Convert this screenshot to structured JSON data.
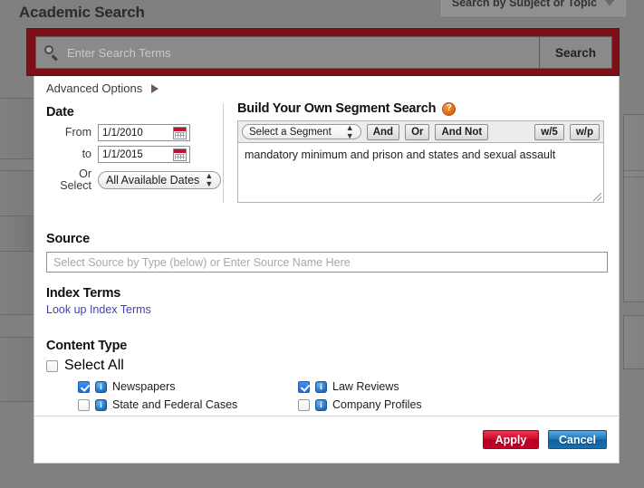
{
  "header": {
    "title": "Academic Search",
    "subject_tab_label": "Search by Subject or Topic"
  },
  "search_bar": {
    "placeholder": "Enter Search Terms",
    "value": "",
    "button_label": "Search",
    "icon": "search-icon"
  },
  "advanced_options": {
    "label": "Advanced Options",
    "caret_icon": "triangle-right-icon"
  },
  "date": {
    "title": "Date",
    "from_label": "From",
    "from_value": "1/1/2010",
    "to_label": "to",
    "to_value": "1/1/2015",
    "or_select_label": "Or Select",
    "or_select_value": "All Available Dates",
    "calendar_icon": "calendar-icon"
  },
  "segment": {
    "title": "Build Your Own Segment Search",
    "help_icon": "help-icon",
    "help_glyph": "?",
    "select_label": "Select a Segment",
    "buttons": [
      "And",
      "Or",
      "And Not",
      "w/5",
      "w/p"
    ],
    "query_text": "mandatory minimum and prison and states and sexual assault"
  },
  "source": {
    "title": "Source",
    "placeholder": "Select Source by Type (below) or Enter Source Name Here",
    "value": ""
  },
  "index_terms": {
    "title": "Index Terms",
    "link_label": "Look up Index Terms"
  },
  "content_type": {
    "title": "Content Type",
    "select_all_label": "Select All",
    "select_all_checked": false,
    "items": [
      {
        "label": "Newspapers",
        "checked": true
      },
      {
        "label": "Law Reviews",
        "checked": true
      },
      {
        "label": "State and Federal Cases",
        "checked": false
      },
      {
        "label": "Company Profiles",
        "checked": false
      }
    ]
  },
  "footer": {
    "apply_label": "Apply",
    "cancel_label": "Cancel"
  },
  "colors": {
    "band_red": "#7b1019",
    "apply_red": "#cf0a2c",
    "cancel_blue": "#1f78bb",
    "link_blue": "#3f3fbf",
    "backdrop_gray": "#808080"
  }
}
